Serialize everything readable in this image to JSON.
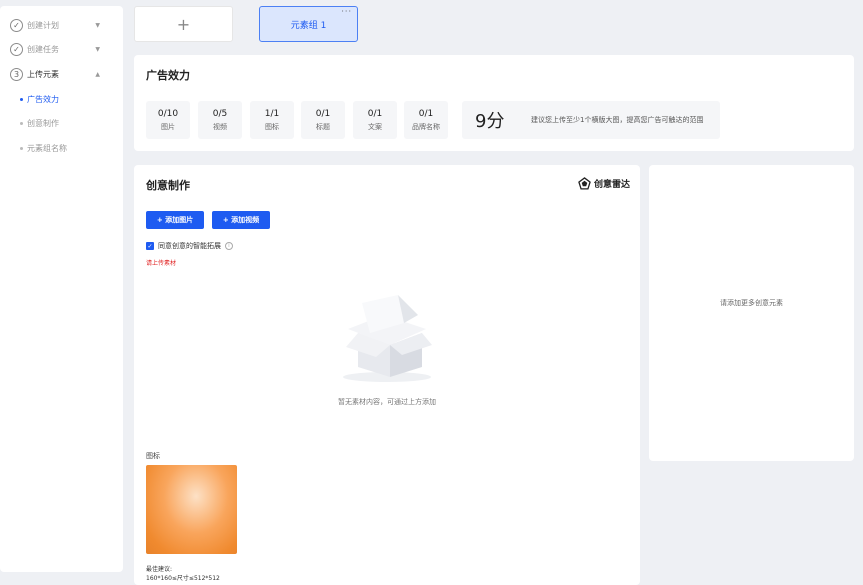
{
  "sidebar": {
    "steps": [
      {
        "label": "创建计划",
        "icon": "check"
      },
      {
        "label": "创建任务",
        "icon": "check"
      },
      {
        "label": "上传元素",
        "number": "3"
      }
    ],
    "subs": [
      "广告效力",
      "创意制作",
      "元素组名称"
    ]
  },
  "tabs": {
    "add": "+",
    "group": "元素组 1",
    "more": "···"
  },
  "effect": {
    "title": "广告效力",
    "stats": [
      {
        "value": "0/10",
        "label": "图片"
      },
      {
        "value": "0/5",
        "label": "视频"
      },
      {
        "value": "1/1",
        "label": "图标"
      },
      {
        "value": "0/1",
        "label": "标题"
      },
      {
        "value": "0/1",
        "label": "文案"
      },
      {
        "value": "0/1",
        "label": "品牌名称"
      }
    ],
    "score": "9分",
    "tip": "建议您上传至少1个横版大图，提高您广告可触达的范围"
  },
  "creative": {
    "title": "创意制作",
    "radar": "创意雷达",
    "add_image": "+ 添加图片",
    "add_video": "+ 添加视频",
    "checkbox_label": "同意创意的智能拓展",
    "error": "请上传素材",
    "empty": "暂无素材内容，可通过上方添加",
    "icon_label": "图标",
    "hint_line1": "最佳建议:",
    "hint_line2": "160*160≤尺寸≤512*512"
  },
  "right": {
    "message": "请添加更多创意元素"
  },
  "colors": {
    "accent": "#1e5bf1",
    "error": "#e02020"
  }
}
